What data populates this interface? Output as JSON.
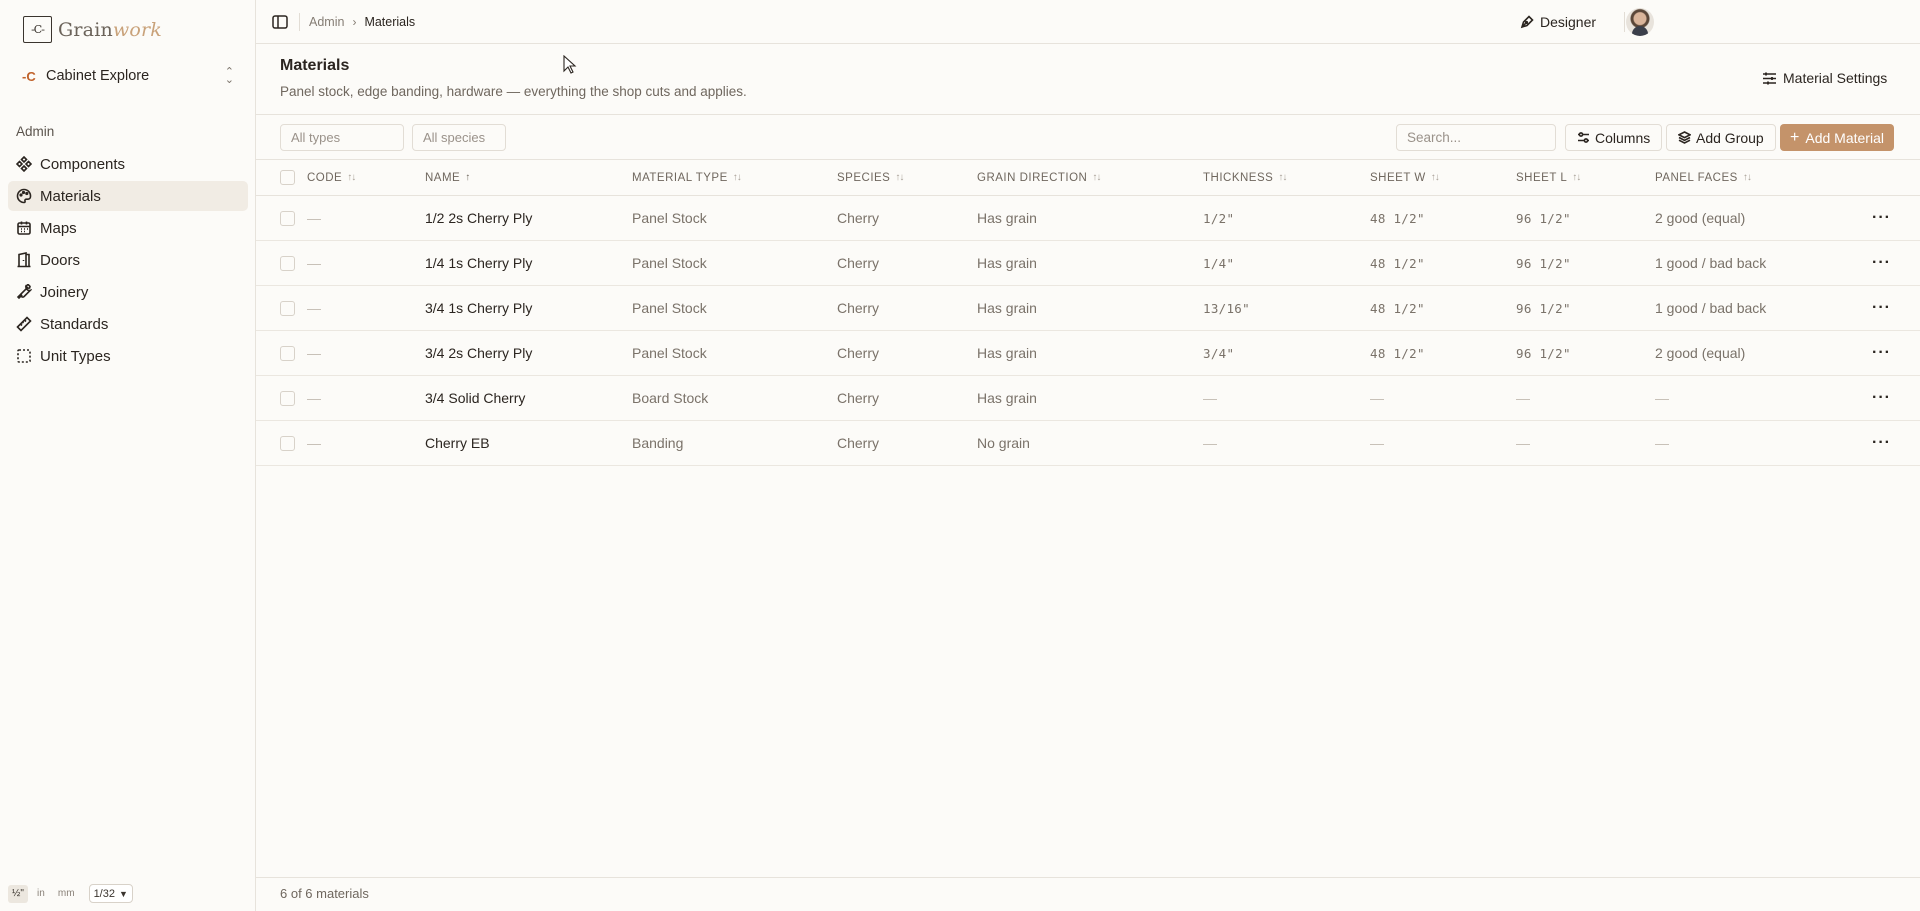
{
  "app": {
    "brand_prefix": "Grain",
    "brand_suffix": "work",
    "logo_mark": "-C-"
  },
  "project": {
    "name": "Cabinet Explore"
  },
  "sidebar": {
    "section": "Admin",
    "items": [
      {
        "label": "Components",
        "icon": "components-icon",
        "active": false
      },
      {
        "label": "Materials",
        "icon": "palette-icon",
        "active": true
      },
      {
        "label": "Maps",
        "icon": "calendar-icon",
        "active": false
      },
      {
        "label": "Doors",
        "icon": "door-icon",
        "active": false
      },
      {
        "label": "Joinery",
        "icon": "wrench-icon",
        "active": false
      },
      {
        "label": "Standards",
        "icon": "ruler-icon",
        "active": false
      },
      {
        "label": "Unit Types",
        "icon": "dashed-square-icon",
        "active": false
      }
    ]
  },
  "units": {
    "fraction": "½\"",
    "inches": "in",
    "mm": "mm",
    "precision": "1/32",
    "selected": "fraction"
  },
  "breadcrumb": {
    "parent": "Admin",
    "current": "Materials"
  },
  "topbar": {
    "designer_label": "Designer"
  },
  "page": {
    "title": "Materials",
    "subtitle": "Panel stock, edge banding, hardware — everything the shop cuts and applies.",
    "settings_label": "Material Settings"
  },
  "filters": {
    "type_placeholder": "All types",
    "species_placeholder": "All species",
    "search_placeholder": "Search...",
    "columns_label": "Columns",
    "add_group_label": "Add Group",
    "add_material_label": "Add Material"
  },
  "table": {
    "headers": {
      "code": "CODE",
      "name": "NAME",
      "material_type": "MATERIAL TYPE",
      "species": "SPECIES",
      "grain": "GRAIN DIRECTION",
      "thickness": "THICKNESS",
      "sheet_w": "SHEET W",
      "sheet_l": "SHEET L",
      "faces": "PANEL FACES"
    },
    "sorted_column": "name",
    "rows": [
      {
        "code": "—",
        "name": "1/2 2s Cherry Ply",
        "type": "Panel Stock",
        "species": "Cherry",
        "grain": "Has grain",
        "thickness": "1/2\"",
        "sheet_w": "48 1/2\"",
        "sheet_l": "96 1/2\"",
        "faces": "2 good (equal)"
      },
      {
        "code": "—",
        "name": "1/4 1s Cherry Ply",
        "type": "Panel Stock",
        "species": "Cherry",
        "grain": "Has grain",
        "thickness": "1/4\"",
        "sheet_w": "48 1/2\"",
        "sheet_l": "96 1/2\"",
        "faces": "1 good / bad back"
      },
      {
        "code": "—",
        "name": "3/4 1s Cherry Ply",
        "type": "Panel Stock",
        "species": "Cherry",
        "grain": "Has grain",
        "thickness": "13/16\"",
        "sheet_w": "48 1/2\"",
        "sheet_l": "96 1/2\"",
        "faces": "1 good / bad back"
      },
      {
        "code": "—",
        "name": "3/4 2s Cherry Ply",
        "type": "Panel Stock",
        "species": "Cherry",
        "grain": "Has grain",
        "thickness": "3/4\"",
        "sheet_w": "48 1/2\"",
        "sheet_l": "96 1/2\"",
        "faces": "2 good (equal)"
      },
      {
        "code": "—",
        "name": "3/4 Solid Cherry",
        "type": "Board Stock",
        "species": "Cherry",
        "grain": "Has grain",
        "thickness": "—",
        "sheet_w": "—",
        "sheet_l": "—",
        "faces": "—"
      },
      {
        "code": "—",
        "name": "Cherry EB",
        "type": "Banding",
        "species": "Cherry",
        "grain": "No grain",
        "thickness": "—",
        "sheet_w": "—",
        "sheet_l": "—",
        "faces": "—"
      }
    ]
  },
  "footer": {
    "count_text": "6 of 6 materials"
  },
  "colors": {
    "accent": "#c4936a",
    "active_nav": "#f1ece4",
    "background": "#fcfbf8",
    "brand_orange": "#c0622b"
  }
}
